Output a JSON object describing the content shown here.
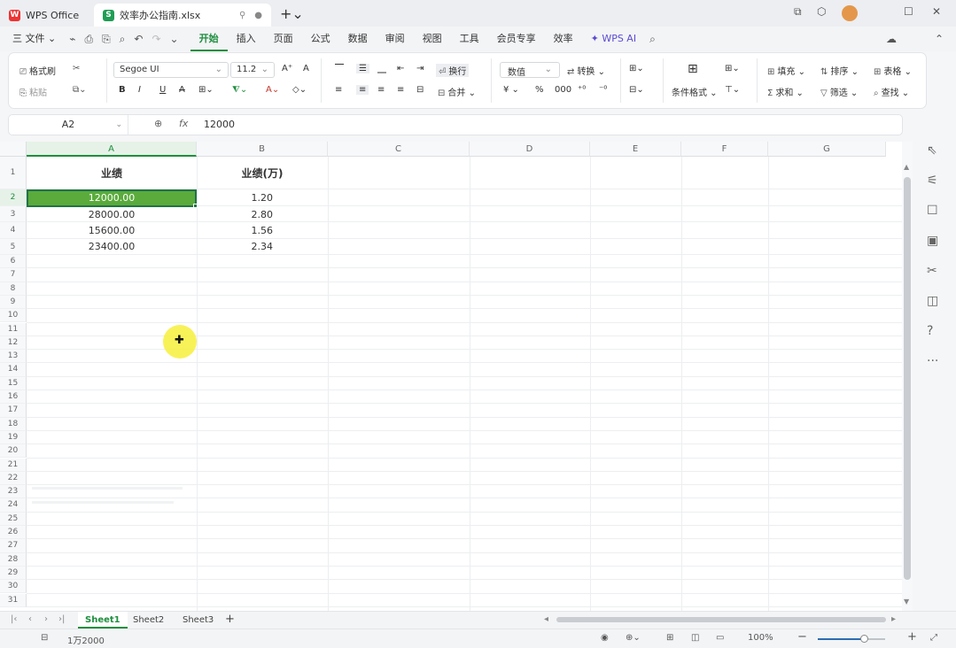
{
  "titlebar": {
    "app_tab": "WPS Office",
    "doc_tab": "效率办公指南.xlsx",
    "new_tab_icon": "plus-icon"
  },
  "menu": {
    "file": "三 文件 ⌄",
    "tabs": [
      "开始",
      "插入",
      "页面",
      "公式",
      "数据",
      "审阅",
      "视图",
      "工具",
      "会员专享",
      "效率"
    ],
    "active_tab": "开始",
    "ai": "WPS AI"
  },
  "ribbon": {
    "format_painter": "格式刷",
    "paste": "粘贴",
    "font_name": "Segoe UI",
    "font_size": "11.2",
    "wrap": "换行",
    "merge": "合并",
    "number_format": "数值",
    "convert": "转换",
    "conditional": "条件格式",
    "fill": "填充",
    "sort": "排序",
    "sheet": "表格",
    "sum": "求和",
    "filter": "筛选",
    "find": "查找"
  },
  "formula_bar": {
    "cell_ref": "A2",
    "formula": "12000"
  },
  "sheet": {
    "columns": [
      "A",
      "B",
      "C",
      "D",
      "E",
      "F",
      "G"
    ],
    "selected_column": "A",
    "selected_row": "2",
    "rows": [
      "1",
      "2",
      "3",
      "4",
      "5",
      "6",
      "7",
      "8",
      "9",
      "10",
      "11",
      "12",
      "13",
      "14",
      "15",
      "16",
      "17",
      "18",
      "19",
      "20",
      "21",
      "22",
      "23",
      "24",
      "25",
      "26",
      "27",
      "28",
      "29",
      "30",
      "31"
    ],
    "header_a": "业绩",
    "header_b": "业绩(万)",
    "data": [
      {
        "a": "12000.00",
        "b": "1.20"
      },
      {
        "a": "28000.00",
        "b": "2.80"
      },
      {
        "a": "15600.00",
        "b": "1.56"
      },
      {
        "a": "23400.00",
        "b": "2.34"
      }
    ]
  },
  "sheet_tabs": [
    "Sheet1",
    "Sheet2",
    "Sheet3"
  ],
  "active_sheet": "Sheet1",
  "status": {
    "value": "1万2000",
    "zoom": "100%"
  },
  "colors": {
    "accent": "#1e8e3e",
    "selection_fill": "#5aab3c"
  }
}
